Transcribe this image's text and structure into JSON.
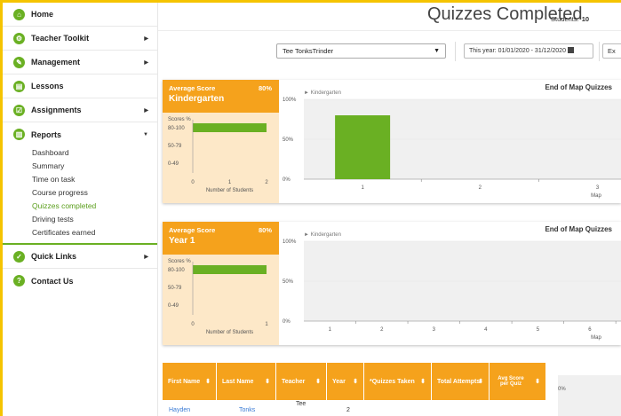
{
  "sidebar": {
    "home": "Home",
    "teacher_toolkit": "Teacher Toolkit",
    "management": "Management",
    "lessons": "Lessons",
    "assignments": "Assignments",
    "reports": "Reports",
    "reports_items": [
      "Dashboard",
      "Summary",
      "Time on task",
      "Course progress",
      "Quizzes completed",
      "Driving tests",
      "Certificates earned"
    ],
    "quick_links": "Quick Links",
    "contact_us": "Contact Us"
  },
  "header": {
    "title": "Quizzes Completed",
    "students_label": "Students:",
    "students_count": "10"
  },
  "filters": {
    "teacher_select": "Tee TonksTrinder",
    "date_range": "This year: 01/01/2020 - 31/12/2020",
    "export_label": "Ex"
  },
  "panels": [
    {
      "avg_label": "Average Score",
      "avg_value": "80%",
      "grade": "Kindergarten",
      "scores_label": "Scores %",
      "score_bands": [
        "80-100",
        "50-79",
        "0-49"
      ],
      "x_ticks": [
        "0",
        "1",
        "2"
      ],
      "x_label": "Number of Students",
      "chart_title": "End of Map Quizzes",
      "legend": "Kindergarten",
      "y_ticks": [
        "100%",
        "50%",
        "0%"
      ],
      "maps": [
        "1",
        "2",
        "3"
      ],
      "map_label": "Map"
    },
    {
      "avg_label": "Average Score",
      "avg_value": "80%",
      "grade": "Year 1",
      "scores_label": "Scores %",
      "score_bands": [
        "80-100",
        "50-79",
        "0-49"
      ],
      "x_ticks": [
        "0",
        "1"
      ],
      "x_label": "Number of Students",
      "chart_title": "End of Map Quizzes",
      "legend": "Kindergarten",
      "y_ticks": [
        "100%",
        "50%",
        "0%"
      ],
      "maps": [
        "1",
        "2",
        "3",
        "4",
        "5",
        "6"
      ],
      "map_label": "Map"
    }
  ],
  "chart_data": [
    {
      "type": "bar",
      "categories": [
        "80-100",
        "50-79",
        "0-49"
      ],
      "values": [
        2,
        0,
        0
      ],
      "xlabel": "Number of Students",
      "ylabel": "Scores %",
      "xlim": [
        0,
        2
      ]
    },
    {
      "type": "bar",
      "categories": [
        "1",
        "2",
        "3"
      ],
      "values": [
        80,
        0,
        0
      ],
      "title": "End of Map Quizzes",
      "xlabel": "Map",
      "ylim": [
        0,
        100
      ],
      "series": [
        {
          "name": "Kindergarten",
          "values": [
            80,
            0,
            0
          ]
        }
      ]
    },
    {
      "type": "bar",
      "categories": [
        "80-100",
        "50-79",
        "0-49"
      ],
      "values": [
        1,
        0,
        0
      ],
      "xlabel": "Number of Students",
      "ylabel": "Scores %",
      "xlim": [
        0,
        1
      ]
    },
    {
      "type": "bar",
      "categories": [
        "1",
        "2",
        "3",
        "4",
        "5",
        "6"
      ],
      "values": [
        0,
        0,
        0,
        0,
        0,
        0
      ],
      "title": "End of Map Quizzes",
      "xlabel": "Map",
      "ylim": [
        0,
        100
      ],
      "series": [
        {
          "name": "Kindergarten",
          "values": [
            0,
            0,
            0,
            0,
            0,
            0
          ]
        }
      ]
    }
  ],
  "table": {
    "headers": [
      "First Name",
      "Last Name",
      "Teacher",
      "Year",
      "*Quizzes Taken",
      "Total Attempts",
      "Avg Score per Quiz"
    ],
    "row": [
      "Hayden",
      "Tonks",
      "Tee",
      "2"
    ],
    "side_axis": "0%"
  },
  "colors": {
    "accent": "#6ab023",
    "orange": "#f5a21c",
    "frame": "#f5c400"
  }
}
